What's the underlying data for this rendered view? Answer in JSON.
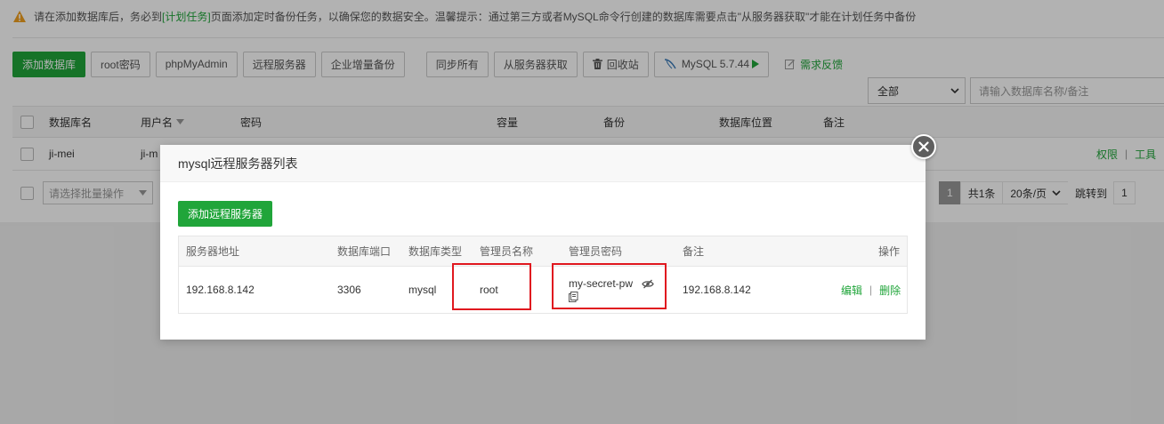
{
  "notice": {
    "prefix": "请在添加数据库后，务必到",
    "link": "[计划任务]",
    "suffix": "页面添加定时备份任务，以确保您的数据安全。温馨提示：通过第三方或者MySQL命令行创建的数据库需要点击\"从服务器获取\"才能在计划任务中备份"
  },
  "toolbar": {
    "add_db": "添加数据库",
    "root_pw": "root密码",
    "phpmyadmin": "phpMyAdmin",
    "remote_server": "远程服务器",
    "enterprise_backup": "企业增量备份",
    "sync_all": "同步所有",
    "fetch_from_server": "从服务器获取",
    "recycle_bin": "回收站",
    "mysql_version": "MySQL 5.7.44",
    "feedback": "需求反馈"
  },
  "filter": {
    "scope": "全部",
    "search_placeholder": "请输入数据库名称/备注"
  },
  "db_table": {
    "columns": [
      "数据库名",
      "用户名",
      "密码",
      "容量",
      "备份",
      "数据库位置",
      "备注"
    ],
    "rows": [
      {
        "name": "ji-mei",
        "user": "ji-m",
        "ops": [
          "权限",
          "工具"
        ]
      }
    ]
  },
  "footer": {
    "batch_placeholder": "请选择批量操作",
    "page": "1",
    "total": "共1条",
    "per_page": "20条/页",
    "jump_label": "跳转到",
    "jump_value": "1"
  },
  "modal": {
    "title": "mysql远程服务器列表",
    "add_button": "添加远程服务器",
    "columns": [
      "服务器地址",
      "数据库端口",
      "数据库类型",
      "管理员名称",
      "管理员密码",
      "备注",
      "操作"
    ],
    "rows": [
      {
        "address": "192.168.8.142",
        "port": "3306",
        "type": "mysql",
        "admin_name": "root",
        "admin_password": "my-secret-pw",
        "remark": "192.168.8.142",
        "edit": "编辑",
        "delete": "删除"
      }
    ]
  },
  "colors": {
    "accent": "#20a53a",
    "highlight": "#e0181f",
    "warning": "#f0a020"
  }
}
